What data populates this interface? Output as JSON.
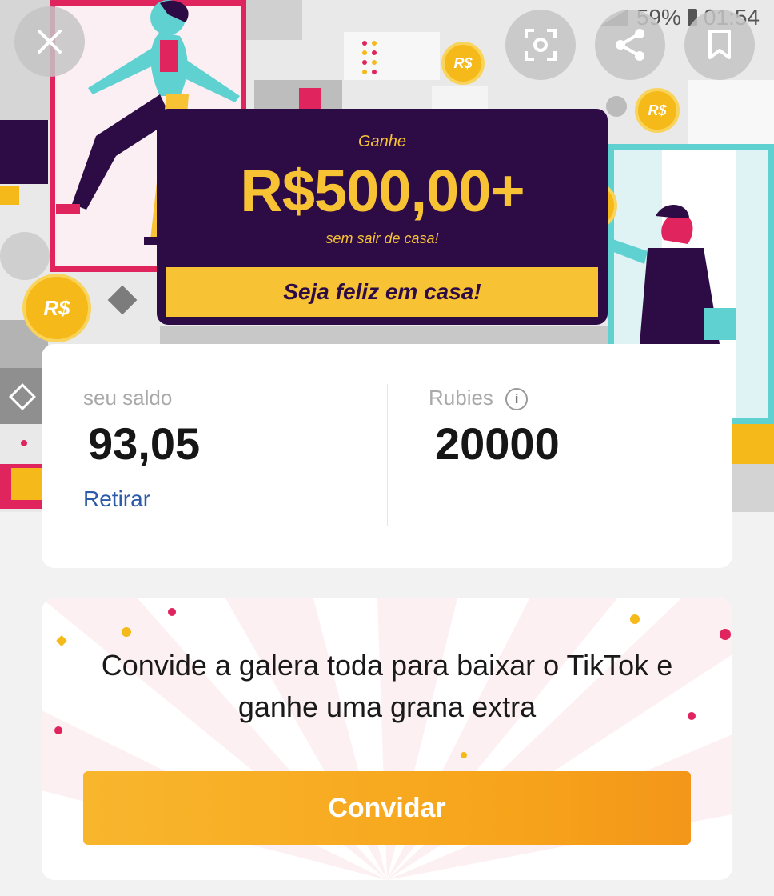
{
  "status_bar": {
    "battery": "59%",
    "time": "01:54"
  },
  "overlay": {
    "close_icon": "close-icon",
    "lens_icon": "lens-icon",
    "share_icon": "share-icon",
    "bookmark_icon": "bookmark-icon"
  },
  "banner": {
    "eyebrow": "Ganhe",
    "amount": "R$500,00+",
    "subtitle": "sem sair de casa!",
    "strip": "Seja feliz em casa!",
    "coin_label": "R$",
    "colors": {
      "panel": "#2d0c46",
      "accent": "#f7c234",
      "frame_left": "#e0245e",
      "frame_right": "#5fd1d1"
    }
  },
  "balance": {
    "label": "seu saldo",
    "value": "93,05",
    "withdraw": "Retirar"
  },
  "rubies": {
    "label": "Rubies",
    "info_icon": "info-icon",
    "value": "20000"
  },
  "invite": {
    "text": "Convide a galera toda para baixar o TikTok e ganhe uma grana extra",
    "button": "Convidar",
    "button_color": "#f8b62d"
  }
}
